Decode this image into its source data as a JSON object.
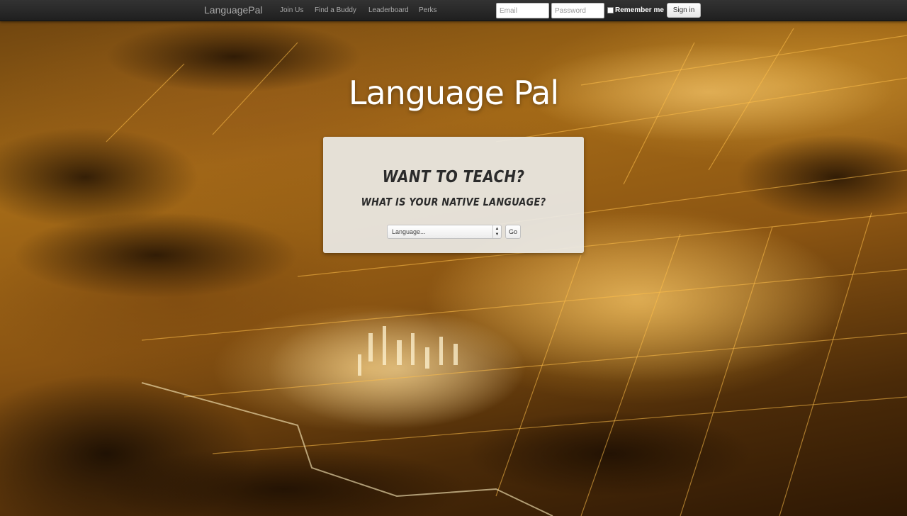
{
  "navbar": {
    "brand": "LanguagePal",
    "links": [
      "Join Us",
      "Find a Buddy",
      "Leaderboard",
      "Perks"
    ],
    "email_placeholder": "Email",
    "password_placeholder": "Password",
    "remember_label": "Remember me",
    "signin_label": "Sign in"
  },
  "hero": {
    "logo": "Language Pal",
    "title": "WANT TO TEACH?",
    "subtitle": "WHAT IS YOUR NATIVE LANGUAGE?",
    "select_value": "Language...",
    "go_label": "Go"
  },
  "colors": {
    "navbar": "#262626",
    "panel": "#ebe9e5",
    "city_glow": "#f0a020"
  },
  "icons": [
    "select-arrows-icon"
  ]
}
